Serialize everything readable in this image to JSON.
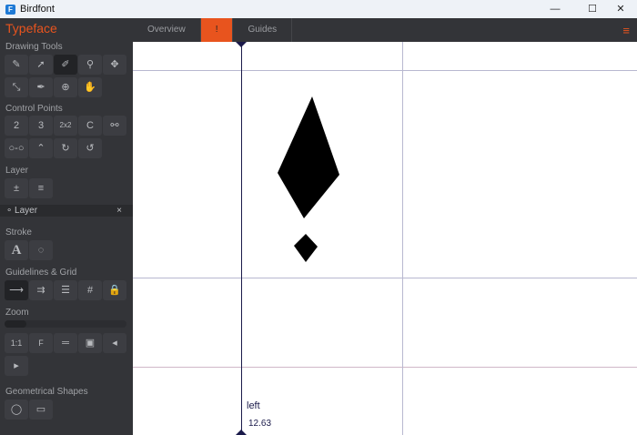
{
  "window": {
    "title": "Birdfont",
    "minimize": "—",
    "maximize": "☐",
    "close": "✕"
  },
  "sidebar": {
    "app_title": "Typeface",
    "sections": {
      "drawing": "Drawing Tools",
      "control": "Control Points",
      "layer": "Layer",
      "stroke": "Stroke",
      "guides": "Guidelines & Grid",
      "zoom": "Zoom",
      "shapes": "Geometrical Shapes"
    },
    "drawing_tools": [
      "pen",
      "pointer",
      "pen-active",
      "zoom",
      "move",
      "resize",
      "knife",
      "move-points",
      "hand"
    ],
    "control_points": [
      "2",
      "3",
      "2x2",
      "C",
      "",
      "",
      " ",
      "",
      ""
    ],
    "layer_item": {
      "label": "Layer",
      "close": "×"
    },
    "zoom_buttons": [
      "1:1",
      "F",
      "",
      "",
      "◂",
      "▸"
    ],
    "zoom_level": 0.18,
    "stroke_letter": "A"
  },
  "tabs": [
    {
      "label": "Overview"
    },
    {
      "label": "!"
    },
    {
      "label": "Guides"
    }
  ],
  "menu_icon": "≡",
  "canvas": {
    "guide_label": "left",
    "guide_value": "12.63"
  }
}
